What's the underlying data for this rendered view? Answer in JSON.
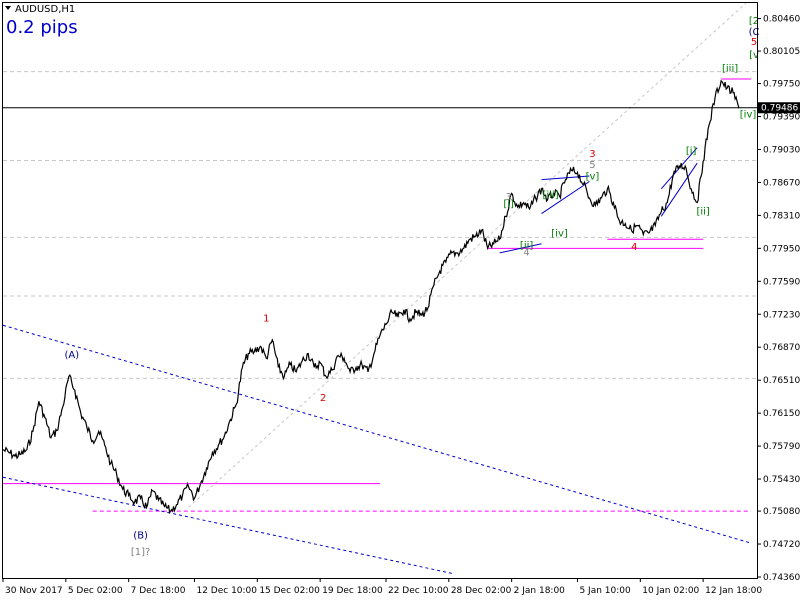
{
  "header": {
    "symbol_label": "AUDUSD,H1",
    "spread_label": "0.2 pips"
  },
  "colors": {
    "price": "#000000",
    "channel": "#0000cc",
    "support": "#ff00ff",
    "dashed_level": "#c8c8c8",
    "wave_red": "#e00000",
    "wave_green": "#008000",
    "wave_blue": "#000080",
    "wave_gray": "#808080"
  },
  "chart_data": {
    "type": "line",
    "title": "",
    "xlabel": "",
    "ylabel": "",
    "ylim": [
      0.7436,
      0.8063
    ],
    "current_price": 0.79486,
    "current_price_label": "0.79486",
    "y_ticks": [
      {
        "value": 0.8046,
        "label": "0.80460"
      },
      {
        "value": 0.80105,
        "label": "0.80105"
      },
      {
        "value": 0.7975,
        "label": "0.79750"
      },
      {
        "value": 0.7939,
        "label": "0.79390"
      },
      {
        "value": 0.7903,
        "label": "0.79030"
      },
      {
        "value": 0.7867,
        "label": "0.78670"
      },
      {
        "value": 0.7831,
        "label": "0.78310"
      },
      {
        "value": 0.7795,
        "label": "0.77950"
      },
      {
        "value": 0.7759,
        "label": "0.77590"
      },
      {
        "value": 0.7723,
        "label": "0.77230"
      },
      {
        "value": 0.7687,
        "label": "0.76870"
      },
      {
        "value": 0.7651,
        "label": "0.76510"
      },
      {
        "value": 0.7615,
        "label": "0.76150"
      },
      {
        "value": 0.7579,
        "label": "0.75790"
      },
      {
        "value": 0.7543,
        "label": "0.75430"
      },
      {
        "value": 0.7508,
        "label": "0.75080"
      },
      {
        "value": 0.7472,
        "label": "0.74720"
      },
      {
        "value": 0.7436,
        "label": "0.74360"
      }
    ],
    "x_ticks": [
      {
        "index": 0,
        "label": "30 Nov 2017"
      },
      {
        "index": 21,
        "label": "5 Dec 02:00"
      },
      {
        "index": 42,
        "label": "7 Dec 18:00"
      },
      {
        "index": 64,
        "label": "12 Dec 10:00"
      },
      {
        "index": 85,
        "label": "15 Dec 02:00"
      },
      {
        "index": 106,
        "label": "19 Dec 18:00"
      },
      {
        "index": 128,
        "label": "22 Dec 10:00"
      },
      {
        "index": 149,
        "label": "28 Dec 02:00"
      },
      {
        "index": 170,
        "label": "2 Jan 18:00"
      },
      {
        "index": 192,
        "label": "5 Jan 10:00"
      },
      {
        "index": 213,
        "label": "10 Jan 02:00"
      },
      {
        "index": 234,
        "label": "12 Jan 18:00"
      }
    ],
    "x": [
      0,
      2,
      4,
      6,
      8,
      10,
      12,
      14,
      16,
      18,
      20,
      22,
      24,
      26,
      28,
      30,
      32,
      34,
      36,
      38,
      40,
      42,
      44,
      46,
      48,
      50,
      52,
      54,
      56,
      58,
      60,
      62,
      64,
      66,
      68,
      70,
      72,
      74,
      76,
      78,
      80,
      82,
      84,
      86,
      88,
      90,
      92,
      94,
      96,
      98,
      100,
      102,
      104,
      106,
      108,
      110,
      112,
      114,
      116,
      118,
      120,
      122,
      124,
      126,
      128,
      130,
      132,
      134,
      136,
      138,
      140,
      142,
      144,
      146,
      148,
      150,
      152,
      154,
      156,
      158,
      160,
      162,
      164,
      166,
      168,
      170,
      172,
      174,
      176,
      178,
      180,
      182,
      184,
      186,
      188,
      190,
      192,
      194,
      196,
      198,
      200,
      202,
      204,
      206,
      208,
      210,
      212,
      214,
      216,
      218,
      220,
      222,
      224,
      226,
      228,
      230,
      232,
      234,
      236,
      238,
      240,
      242,
      244,
      246
    ],
    "series": [
      {
        "name": "",
        "values": [
          0.7575,
          0.7572,
          0.7568,
          0.757,
          0.7575,
          0.7595,
          0.7628,
          0.761,
          0.7588,
          0.7596,
          0.7622,
          0.7655,
          0.764,
          0.7615,
          0.76,
          0.7585,
          0.7595,
          0.758,
          0.756,
          0.7548,
          0.7532,
          0.7525,
          0.7518,
          0.7522,
          0.7512,
          0.753,
          0.752,
          0.7513,
          0.7508,
          0.7515,
          0.7525,
          0.7535,
          0.7522,
          0.7538,
          0.7555,
          0.7572,
          0.758,
          0.759,
          0.7608,
          0.7625,
          0.7665,
          0.768,
          0.7682,
          0.7688,
          0.7675,
          0.7695,
          0.7665,
          0.7655,
          0.7668,
          0.766,
          0.7672,
          0.768,
          0.7665,
          0.767,
          0.7655,
          0.7662,
          0.7678,
          0.7675,
          0.766,
          0.7665,
          0.7668,
          0.766,
          0.768,
          0.77,
          0.7712,
          0.7725,
          0.772,
          0.7728,
          0.7718,
          0.7725,
          0.7722,
          0.773,
          0.7755,
          0.777,
          0.778,
          0.779,
          0.779,
          0.7795,
          0.7805,
          0.7808,
          0.7815,
          0.7795,
          0.78,
          0.7805,
          0.783,
          0.7855,
          0.784,
          0.7845,
          0.7838,
          0.785,
          0.786,
          0.7848,
          0.7855,
          0.7852,
          0.787,
          0.788,
          0.7878,
          0.7865,
          0.785,
          0.7842,
          0.785,
          0.786,
          0.7845,
          0.7825,
          0.7822,
          0.7815,
          0.782,
          0.781,
          0.7812,
          0.782,
          0.7835,
          0.7845,
          0.7875,
          0.7885,
          0.7885,
          0.786,
          0.7845,
          0.789,
          0.793,
          0.796,
          0.7978,
          0.797,
          0.7965,
          0.7948
        ]
      }
    ],
    "horizontal_levels": [
      {
        "name": "dashed-level",
        "value": 0.7988,
        "style": "dashed"
      },
      {
        "name": "dashed-level",
        "value": 0.7891,
        "style": "dashed"
      },
      {
        "name": "dashed-level",
        "value": 0.7807,
        "style": "dashed"
      },
      {
        "name": "dashed-level",
        "value": 0.7743,
        "style": "dashed"
      },
      {
        "name": "dashed-level",
        "value": 0.7653,
        "style": "dashed"
      },
      {
        "name": "support-line",
        "value": 0.7538,
        "style": "solid",
        "color": "support",
        "from": 0,
        "to": 126
      },
      {
        "name": "support-line",
        "value": 0.7508,
        "style": "dashed",
        "color": "support",
        "from": 30,
        "to": 250
      },
      {
        "name": "support-line",
        "value": 0.7795,
        "style": "solid",
        "color": "support",
        "from": 162,
        "to": 234
      },
      {
        "name": "support-line",
        "value": 0.7805,
        "style": "solid",
        "color": "support",
        "from": 202,
        "to": 234
      },
      {
        "name": "support-line",
        "value": 0.798,
        "style": "solid",
        "color": "support",
        "from": 240,
        "to": 250
      }
    ],
    "trend_lines": [
      {
        "name": "channel-upper",
        "x1": 0,
        "y1": 0.7711,
        "x2": 250,
        "y2": 0.7473,
        "style": "dashed",
        "color": "channel"
      },
      {
        "name": "channel-lower",
        "x1": 0,
        "y1": 0.7545,
        "x2": 150,
        "y2": 0.744,
        "style": "dashed",
        "color": "channel"
      },
      {
        "name": "fib-diagonal",
        "x1": 62,
        "y1": 0.7512,
        "x2": 250,
        "y2": 0.8068,
        "style": "dashed",
        "color": "dashed_level"
      },
      {
        "name": "wedge-line",
        "x1": 166,
        "y1": 0.779,
        "x2": 180,
        "y2": 0.78,
        "style": "solid",
        "color": "channel"
      },
      {
        "name": "wedge-line",
        "x1": 180,
        "y1": 0.7833,
        "x2": 196,
        "y2": 0.7868,
        "style": "solid",
        "color": "channel"
      },
      {
        "name": "wedge-line",
        "x1": 180,
        "y1": 0.787,
        "x2": 196,
        "y2": 0.7874,
        "style": "solid",
        "color": "channel"
      },
      {
        "name": "wedge-line",
        "x1": 220,
        "y1": 0.786,
        "x2": 232,
        "y2": 0.7905,
        "style": "solid",
        "color": "channel"
      },
      {
        "name": "wedge-line",
        "x1": 220,
        "y1": 0.783,
        "x2": 232,
        "y2": 0.7888,
        "style": "solid",
        "color": "channel"
      }
    ],
    "annotations": [
      {
        "text": "(A)",
        "x": 23,
        "y": 0.7675,
        "color": "wave_blue"
      },
      {
        "text": "(B)",
        "x": 46,
        "y": 0.7478,
        "color": "wave_blue"
      },
      {
        "text": "[1]?",
        "x": 46,
        "y": 0.746,
        "color": "wave_gray"
      },
      {
        "text": "1",
        "x": 88,
        "y": 0.7715,
        "color": "wave_red"
      },
      {
        "text": "2",
        "x": 107,
        "y": 0.7628,
        "color": "wave_red"
      },
      {
        "text": "3",
        "x": 197,
        "y": 0.7895,
        "color": "wave_red"
      },
      {
        "text": "5",
        "x": 197,
        "y": 0.7883,
        "color": "wave_gray"
      },
      {
        "text": "[v]",
        "x": 197,
        "y": 0.787,
        "color": "wave_green"
      },
      {
        "text": "3",
        "x": 169,
        "y": 0.7848,
        "color": "wave_gray"
      },
      {
        "text": "[i]",
        "x": 169,
        "y": 0.784,
        "color": "wave_green"
      },
      {
        "text": "[iii]",
        "x": 183,
        "y": 0.785,
        "color": "wave_green"
      },
      {
        "text": "[iv]",
        "x": 186,
        "y": 0.7808,
        "color": "wave_green"
      },
      {
        "text": "[ii]",
        "x": 175,
        "y": 0.7795,
        "color": "wave_green"
      },
      {
        "text": "4",
        "x": 175,
        "y": 0.7787,
        "color": "wave_gray"
      },
      {
        "text": "4",
        "x": 211,
        "y": 0.7793,
        "color": "wave_red"
      },
      {
        "text": "[i]",
        "x": 230,
        "y": 0.7898,
        "color": "wave_green"
      },
      {
        "text": "[ii]",
        "x": 234,
        "y": 0.7832,
        "color": "wave_green"
      },
      {
        "text": "[iii]",
        "x": 243,
        "y": 0.7988,
        "color": "wave_green"
      },
      {
        "text": "[iv]",
        "x": 249,
        "y": 0.7938,
        "color": "wave_green"
      },
      {
        "text": "[2",
        "x": 251,
        "y": 0.804,
        "color": "wave_green"
      },
      {
        "text": "(C",
        "x": 251,
        "y": 0.8028,
        "color": "wave_blue"
      },
      {
        "text": "5",
        "x": 251,
        "y": 0.8017,
        "color": "wave_red"
      },
      {
        "text": "[v",
        "x": 251,
        "y": 0.8003,
        "color": "wave_green"
      }
    ]
  }
}
